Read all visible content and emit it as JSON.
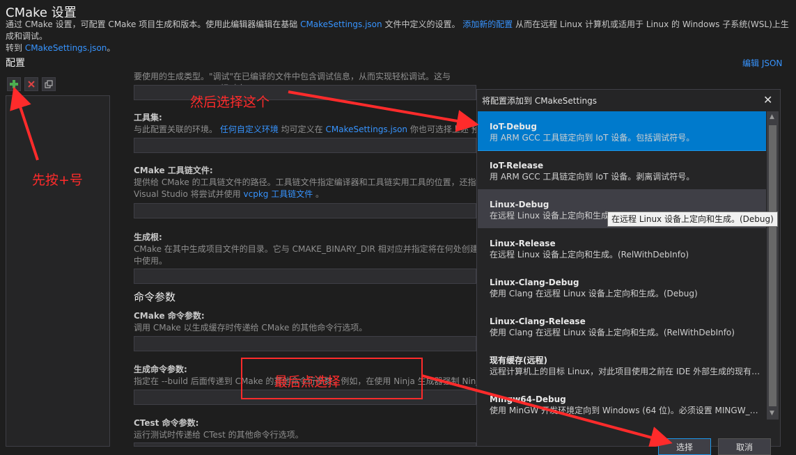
{
  "header": {
    "title": "CMake 设置",
    "desc_part1": "通过 CMake 设置，可配置 CMake 项目生成和版本。使用此编辑器编辑在基础 ",
    "desc_link1": "CMakeSettings.json",
    "desc_part2": " 文件中定义的设置。 ",
    "desc_link2": "添加新的配置",
    "desc_part3": " 从而在远程 Linux 计算机或适用于 Linux 的 Windows 子系统(WSL)上生成和调试。",
    "desc_part4": "转到 ",
    "desc_link3": "CMakeSettings.json",
    "desc_part5": "。"
  },
  "config": {
    "title": "配置",
    "edit_json": "编辑 JSON"
  },
  "toolbar": {
    "add_icon": "plus-icon",
    "delete_icon": "x-icon",
    "copy_icon": "copy-icon"
  },
  "fields": {
    "build_type_desc": "要使用的生成类型。\"调试\"在已编译的文件中包含调试信息，从而实现轻松调试。这与 CMAKE_BUILD_TYPE 相对应。",
    "toolset_label": "工具集:",
    "toolset_desc_part1": "与此配置关联的环境。 ",
    "toolset_desc_link1": "任何自定义环境",
    "toolset_desc_part2": " 均可定义在 ",
    "toolset_desc_link2": "CMakeSettings.json",
    "toolset_desc_part3": " 你也可选择上述 预",
    "toolchain_label": "CMake 工具链文件:",
    "toolchain_desc_line1": "提供给 CMake 的工具链文件的路径。工具链文件指定编译器和工具链实用工具的位置，还指",
    "toolchain_desc_line2_part1": "Visual Studio 将尝试并使用 ",
    "toolchain_desc_link": "vcpkg 工具链文件",
    "toolchain_desc_line2_part2": " 。",
    "buildroot_label": "生成根:",
    "buildroot_desc_line1": "CMake 在其中生成项目文件的目录。它与 CMAKE_BINARY_DIR 相对应并指定将在何处创建",
    "buildroot_desc_line2": "中使用。",
    "section_cmd": "命令参数",
    "cmake_args_label": "CMake 命令参数:",
    "cmake_args_desc": "调用 CMake 以生成缓存时传递给 CMake 的其他命令行选项。",
    "build_args_label": "生成命令参数:",
    "build_args_desc": "指定在 --build 后面传递到 CMake 的其他命令行参数，例如，在使用 Ninja 生成器强制 Ninja",
    "ctest_label": "CTest 命令参数:",
    "ctest_desc": "运行测试时传递给 CTest 的其他命令行选项。"
  },
  "dialog": {
    "title": "将配置添加到 CMakeSettings",
    "close_icon": "close-icon",
    "items": [
      {
        "name": "IoT-Debug",
        "desc": "用 ARM GCC 工具链定向到 IoT 设备。包括调试符号。"
      },
      {
        "name": "IoT-Release",
        "desc": "用 ARM GCC 工具链定向到 IoT 设备。剥离调试符号。"
      },
      {
        "name": "Linux-Debug",
        "desc": "在远程 Linux 设备上定向和生成。(Debug)"
      },
      {
        "name": "Linux-Release",
        "desc": "在远程 Linux 设备上定向和生成。(RelWithDebInfo)"
      },
      {
        "name": "Linux-Clang-Debug",
        "desc": "使用 Clang 在远程 Linux 设备上定向和生成。(Debug)"
      },
      {
        "name": "Linux-Clang-Release",
        "desc": "使用 Clang 在远程 Linux 设备上定向和生成。(RelWithDebInfo)"
      },
      {
        "name": "现有缓存(远程)",
        "desc": "远程计算机上的目标 Linux，对此项目使用之前在 IDE 外部生成的现有缓存。"
      },
      {
        "name": "Mingw64-Debug",
        "desc": "使用 MinGW 开发环境定向到 Windows (64 位)。必须设置 MINGW_PREFIX。"
      }
    ],
    "tooltip": "在远程 Linux 设备上定向和生成。(Debug)",
    "select_label": "选择",
    "cancel_label": "取消"
  },
  "annotations": {
    "step1": "先按+号",
    "step2": "然后选择这个",
    "step3": "最后点选择",
    "color": "#ff2b2b"
  }
}
